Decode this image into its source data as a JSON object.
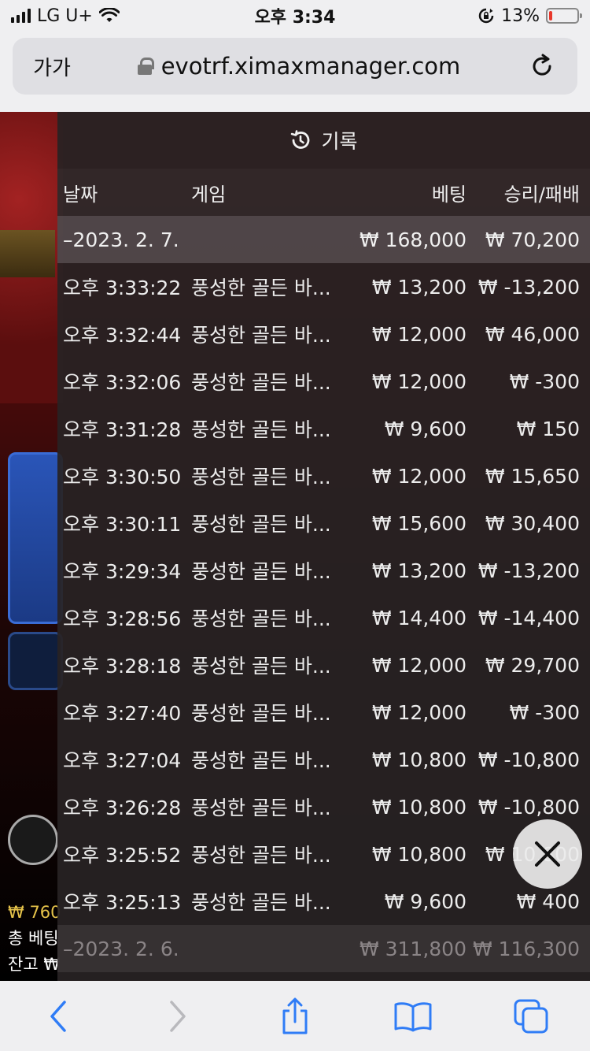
{
  "status_bar": {
    "carrier": "LG U+",
    "time": "오후 3:34",
    "battery_percent": "13%",
    "battery_level": 0.13
  },
  "browser": {
    "text_size_label": "가가",
    "url": "evotrf.ximaxmanager.com"
  },
  "background": {
    "balance_line": "₩ 760",
    "total_bet_line": "총 베팅",
    "balance_label": "잔고 ₩"
  },
  "history": {
    "title": "기록",
    "columns": {
      "date": "날짜",
      "game": "게임",
      "bet": "베팅",
      "win_loss": "승리/패배"
    },
    "day": {
      "date": "–2023. 2. 7.",
      "bet": "₩ 168,000",
      "win_loss": "₩ 70,200"
    },
    "rows": [
      {
        "time": "오후 3:33:22",
        "game": "풍성한 골든 바...",
        "bet": "₩ 13,200",
        "win_loss": "₩ -13,200"
      },
      {
        "time": "오후 3:32:44",
        "game": "풍성한 골든 바...",
        "bet": "₩ 12,000",
        "win_loss": "₩ 46,000"
      },
      {
        "time": "오후 3:32:06",
        "game": "풍성한 골든 바...",
        "bet": "₩ 12,000",
        "win_loss": "₩ -300"
      },
      {
        "time": "오후 3:31:28",
        "game": "풍성한 골든 바...",
        "bet": "₩ 9,600",
        "win_loss": "₩ 150"
      },
      {
        "time": "오후 3:30:50",
        "game": "풍성한 골든 바...",
        "bet": "₩ 12,000",
        "win_loss": "₩ 15,650"
      },
      {
        "time": "오후 3:30:11",
        "game": "풍성한 골든 바...",
        "bet": "₩ 15,600",
        "win_loss": "₩ 30,400"
      },
      {
        "time": "오후 3:29:34",
        "game": "풍성한 골든 바...",
        "bet": "₩ 13,200",
        "win_loss": "₩ -13,200"
      },
      {
        "time": "오후 3:28:56",
        "game": "풍성한 골든 바...",
        "bet": "₩ 14,400",
        "win_loss": "₩ -14,400"
      },
      {
        "time": "오후 3:28:18",
        "game": "풍성한 골든 바...",
        "bet": "₩ 12,000",
        "win_loss": "₩ 29,700"
      },
      {
        "time": "오후 3:27:40",
        "game": "풍성한 골든 바...",
        "bet": "₩ 12,000",
        "win_loss": "₩ -300"
      },
      {
        "time": "오후 3:27:04",
        "game": "풍성한 골든 바...",
        "bet": "₩ 10,800",
        "win_loss": "₩ -10,800"
      },
      {
        "time": "오후 3:26:28",
        "game": "풍성한 골든 바...",
        "bet": "₩ 10,800",
        "win_loss": "₩ -10,800"
      },
      {
        "time": "오후 3:25:52",
        "game": "풍성한 골든 바...",
        "bet": "₩ 10,800",
        "win_loss": "₩ 10,800"
      },
      {
        "time": "오후 3:25:13",
        "game": "풍성한 골든 바...",
        "bet": "₩ 9,600",
        "win_loss": "₩ 400"
      }
    ],
    "prev_day": {
      "date": "–2023. 2. 6.",
      "bet": "₩ 311,800",
      "win_loss": "₩ 116,300"
    }
  },
  "icons": {
    "history": "history-clock-icon",
    "close": "close-icon",
    "back": "chevron-left-icon",
    "forward": "chevron-right-icon",
    "share": "share-icon",
    "bookmarks": "book-icon",
    "tabs": "tabs-icon"
  },
  "colors": {
    "ios_blue": "#2f7cf6",
    "battery_low": "#e8372b"
  }
}
